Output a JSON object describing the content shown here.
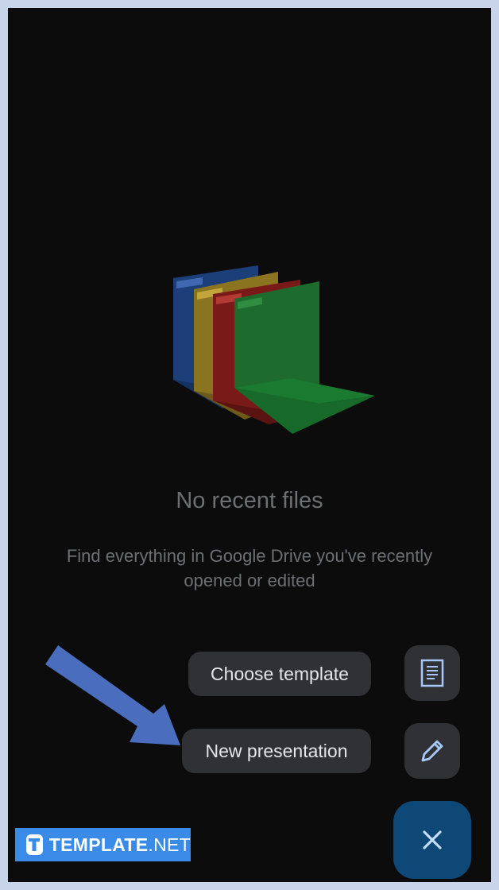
{
  "empty_state": {
    "title": "No recent files",
    "description": "Find everything in Google Drive you've recently opened or edited",
    "illustration": "colored-folders-illustration"
  },
  "speed_dial": {
    "choose_template_label": "Choose template",
    "choose_template_icon": "document-icon",
    "new_presentation_label": "New presentation",
    "new_presentation_icon": "pencil-icon",
    "close_icon": "close-icon"
  },
  "watermark": {
    "brand": "TEMPLATE",
    "suffix": ".NET",
    "logo_letter": "T"
  },
  "colors": {
    "background": "#0c0c0d",
    "pill": "#2f3134",
    "main_fab": "#0e4876",
    "icon_accent": "#a8c7fa",
    "arrow": "#4a6dbd",
    "watermark": "#3a8be8"
  }
}
